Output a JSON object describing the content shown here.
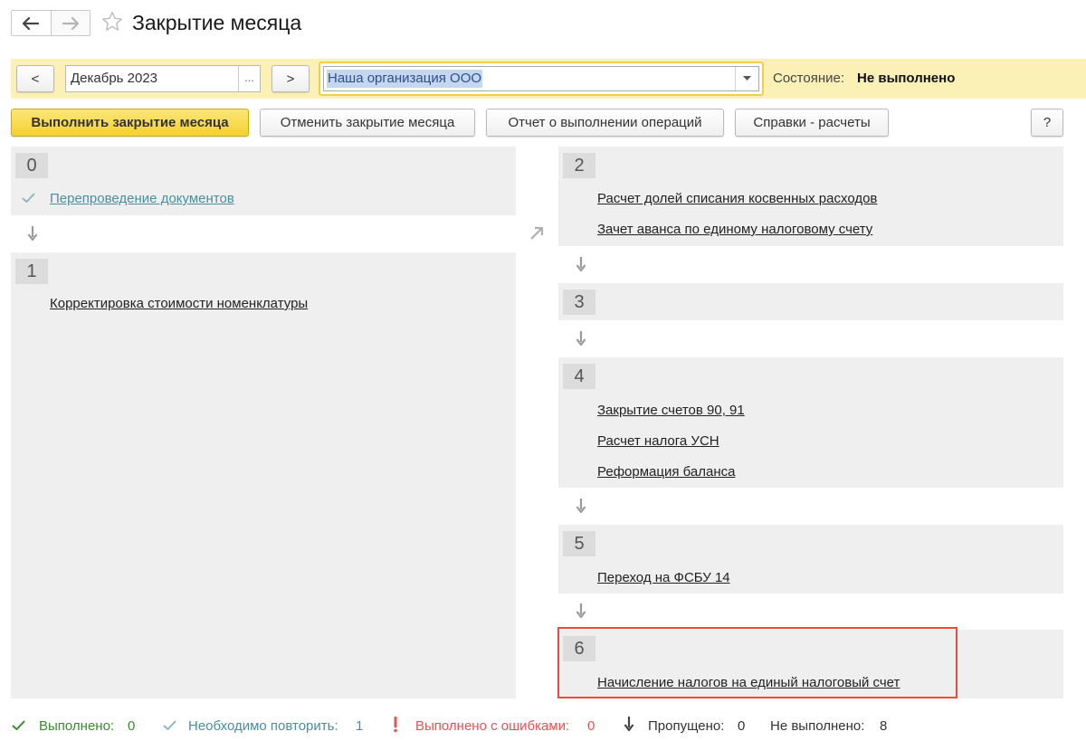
{
  "window": {
    "title": "Закрытие месяца"
  },
  "filter": {
    "prev_label": "<",
    "next_label": ">",
    "period": "Декабрь 2023",
    "period_choose": "...",
    "organization": "Наша организация ООО",
    "status_label": "Состояние:",
    "status_value": "Не выполнено"
  },
  "toolbar": {
    "run": "Выполнить закрытие месяца",
    "cancel": "Отменить закрытие месяца",
    "report": "Отчет о выполнении операций",
    "calcs": "Справки - расчеты",
    "help": "?"
  },
  "stages": {
    "s0": {
      "num": "0",
      "ops": [
        "Перепроведение документов"
      ]
    },
    "s1": {
      "num": "1",
      "ops": [
        "Корректировка стоимости номенклатуры"
      ]
    },
    "s2": {
      "num": "2",
      "ops": [
        "Расчет долей списания косвенных расходов",
        "Зачет аванса по единому налоговому счету"
      ]
    },
    "s3": {
      "num": "3",
      "ops": []
    },
    "s4": {
      "num": "4",
      "ops": [
        "Закрытие счетов 90, 91",
        "Расчет налога УСН",
        "Реформация баланса"
      ]
    },
    "s5": {
      "num": "5",
      "ops": [
        "Переход на ФСБУ 14"
      ]
    },
    "s6": {
      "num": "6",
      "ops": [
        "Начисление налогов на единый налоговый счет"
      ]
    }
  },
  "legend": {
    "done_label": "Выполнено:",
    "done_count": "0",
    "repeat_label": "Необходимо повторить:",
    "repeat_count": "1",
    "errors_label": "Выполнено с ошибками:",
    "errors_count": "0",
    "skipped_label": "Пропущено:",
    "skipped_count": "0",
    "notdone_label": "Не выполнено:",
    "notdone_count": "8"
  },
  "colors": {
    "accent_yellow": "#f5d12e",
    "filter_bar": "#fbf0b5",
    "done_green": "#3a8a2e",
    "repeat_teal": "#4a8e9e",
    "error_red": "#e05555",
    "highlight_red": "#e74c3c"
  }
}
